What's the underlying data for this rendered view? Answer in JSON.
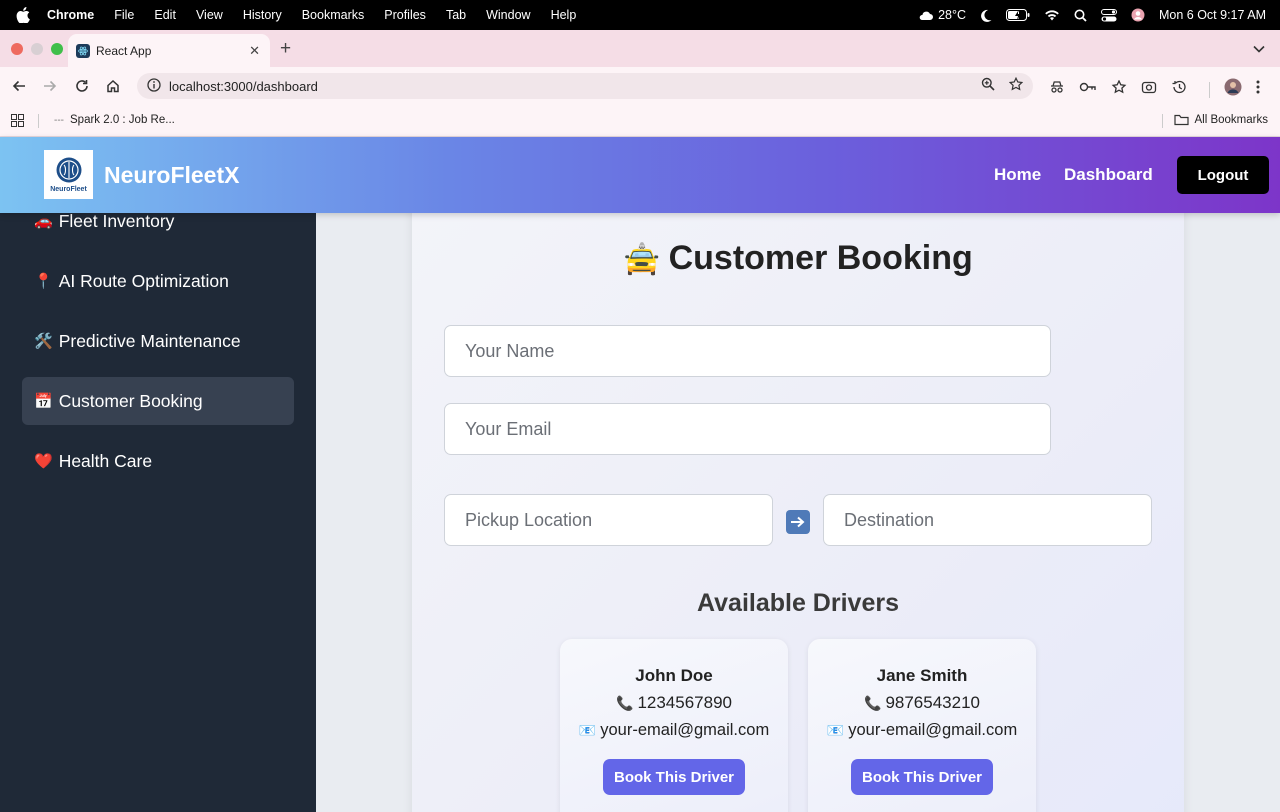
{
  "menubar": {
    "app_name": "Chrome",
    "items": [
      "File",
      "Edit",
      "View",
      "History",
      "Bookmarks",
      "Profiles",
      "Tab",
      "Window",
      "Help"
    ],
    "weather": "28°C",
    "datetime": "Mon 6 Oct  9:17 AM"
  },
  "browser": {
    "tab_title": "React App",
    "url": "localhost:3000/dashboard",
    "bookmark_item": "Spark 2.0 : Job Re...",
    "all_bookmarks": "All Bookmarks"
  },
  "header": {
    "logo_text": "NeuroFleet",
    "brand": "NeuroFleetX",
    "nav": {
      "home": "Home",
      "dashboard": "Dashboard",
      "logout": "Logout"
    }
  },
  "sidebar": {
    "items": [
      {
        "emoji": "🚗",
        "label": "Fleet Inventory",
        "active": false
      },
      {
        "emoji": "📍",
        "label": "AI Route Optimization",
        "active": false
      },
      {
        "emoji": "🛠️",
        "label": "Predictive Maintenance",
        "active": false
      },
      {
        "emoji": "📅",
        "label": "Customer Booking",
        "active": true
      },
      {
        "emoji": "❤️",
        "label": "Health Care",
        "active": false
      }
    ]
  },
  "booking": {
    "title_emoji": "🚖",
    "title": "Customer Booking",
    "name_placeholder": "Your Name",
    "email_placeholder": "Your Email",
    "pickup_placeholder": "Pickup Location",
    "destination_placeholder": "Destination",
    "drivers_title": "Available Drivers",
    "drivers": [
      {
        "name": "John Doe",
        "phone": "1234567890",
        "email": "your-email@gmail.com",
        "button": "Book This Driver"
      },
      {
        "name": "Jane Smith",
        "phone": "9876543210",
        "email": "your-email@gmail.com",
        "button": "Book This Driver"
      }
    ],
    "phone_emoji": "📞",
    "email_emoji": "📧"
  }
}
